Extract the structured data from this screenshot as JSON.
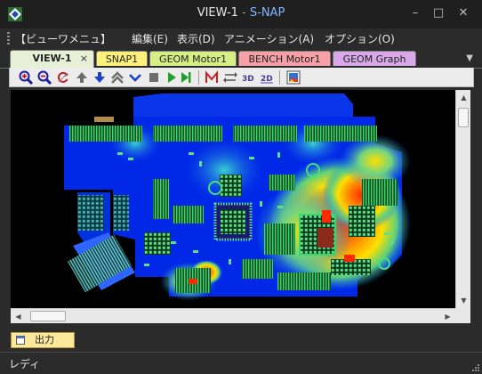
{
  "window": {
    "title_main": "VIEW-1",
    "title_sep": " - ",
    "title_app": "S-NAP",
    "controls": {
      "minimize": "–",
      "maximize": "□",
      "close": "✕"
    }
  },
  "menu": [
    {
      "label": "【ビューワメニュ】"
    },
    {
      "label": "編集(E)"
    },
    {
      "label": "表示(D)"
    },
    {
      "label": "アニメーション(A)"
    },
    {
      "label": "オプション(O)"
    }
  ],
  "tabs": [
    {
      "label": "VIEW-1",
      "active": true,
      "color": "#e7f0d6",
      "close": "×"
    },
    {
      "label": "SNAP1",
      "color": "#fff07a"
    },
    {
      "label": "GEOM Motor1",
      "color": "#d5ef85"
    },
    {
      "label": "BENCH Motor1",
      "color": "#f7a0a8"
    },
    {
      "label": "GEOM Graph",
      "color": "#d8a8e8"
    }
  ],
  "tab_overflow": "▼",
  "toolbar_icons": [
    "zoom-in-icon",
    "zoom-out-icon",
    "reset-view-icon",
    "arrow-up-icon",
    "arrow-down-icon",
    "double-chevron-up-icon",
    "chevron-down-icon",
    "stop-icon",
    "play-icon",
    "play-end-icon",
    "mode-m-icon",
    "swap-icon",
    "3d-view-icon",
    "2d-view-icon",
    "export-image-icon"
  ],
  "output_tab": {
    "label": "出力"
  },
  "status": {
    "text": "レディ"
  },
  "colors": {
    "board_blue": "#0028e6",
    "trace_green": "#2bd46f",
    "hot_red": "#ff2a00",
    "warm_yellow": "#ffe000"
  }
}
